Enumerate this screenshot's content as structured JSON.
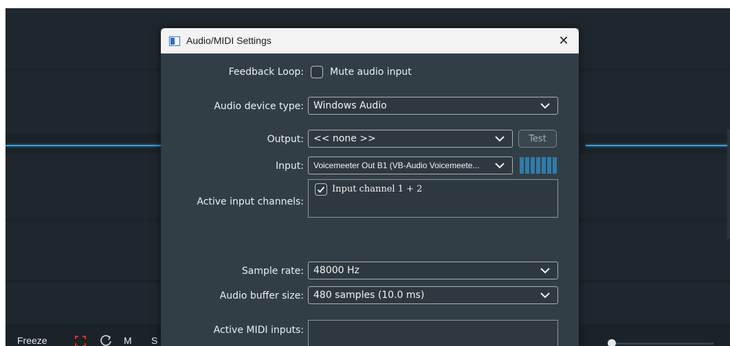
{
  "background": {
    "bottom_bar": {
      "freeze_label": "Freeze",
      "m_label": "M",
      "s_label": "S",
      "freeze_icon": "freeze-icon",
      "loop_icon": "loop-icon"
    },
    "colors": {
      "accent_line": "#3c9fd6",
      "freeze_icon": "#e0312a"
    }
  },
  "dialog": {
    "title": "Audio/MIDI Settings",
    "close_label": "✕",
    "feedback_loop": {
      "label": "Feedback Loop:",
      "checkbox_label": "Mute audio input",
      "checked": false
    },
    "audio_device_type": {
      "label": "Audio device type:",
      "value": "Windows Audio"
    },
    "output": {
      "label": "Output:",
      "value": "<< none >>",
      "test_label": "Test"
    },
    "input": {
      "label": "Input:",
      "value": "Voicemeeter Out B1 (VB-Audio Voicemeete..."
    },
    "active_input_channels": {
      "label": "Active input channels:",
      "items": [
        {
          "label": "Input channel 1 + 2",
          "checked": true
        }
      ]
    },
    "sample_rate": {
      "label": "Sample rate:",
      "value": "48000 Hz"
    },
    "audio_buffer_size": {
      "label": "Audio buffer size:",
      "value": "480 samples (10.0 ms)"
    },
    "active_midi_inputs": {
      "label": "Active MIDI inputs:"
    }
  }
}
